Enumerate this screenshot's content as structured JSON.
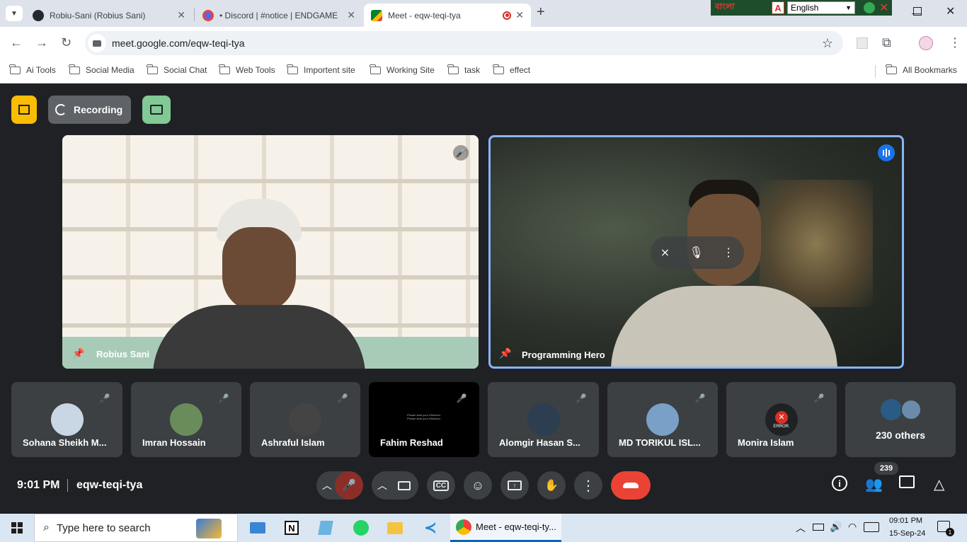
{
  "browser": {
    "tabs": [
      {
        "title": "Robiu-Sani (Robius Sani)",
        "icon": "github-icon"
      },
      {
        "title": "• Discord | #notice | ENDGAME",
        "icon": "discord-icon"
      },
      {
        "title": "Meet - eqw-teqi-tya",
        "icon": "meet-icon",
        "active": true,
        "recording": true
      }
    ],
    "new_tab": "+",
    "url": "meet.google.com/eqw-teqi-tya",
    "extension_language": "English",
    "extension_label": "বাংলা",
    "bookmarks": [
      "Ai Tools",
      "Social Media",
      "Social Chat",
      "Web Tools",
      "Importent site",
      "Working Site",
      "task",
      "effect"
    ],
    "all_bookmarks": "All Bookmarks"
  },
  "meet": {
    "recording_label": "Recording",
    "main_tiles": [
      {
        "name": "Robius Sani",
        "muted": true
      },
      {
        "name": "Programming Hero",
        "speaking": true
      }
    ],
    "participants": [
      {
        "name": "Sohana Sheikh M...",
        "avatar_color": "#c9d6e3"
      },
      {
        "name": "Imran Hossain",
        "avatar_color": "#6a8c5b"
      },
      {
        "name": "Ashraful Islam",
        "avatar_color": "#444"
      },
      {
        "name": "Fahim Reshad",
        "avatar_color": "#000"
      },
      {
        "name": "Alomgir Hasan S...",
        "avatar_color": "#2c3e50"
      },
      {
        "name": "MD TORIKUL ISL...",
        "avatar_color": "#7aa0c8"
      },
      {
        "name": "Monira Islam",
        "avatar_color": "#d93025",
        "avatar_text": "ERROR."
      }
    ],
    "fahim_tile_text": "Please start your Webcam. Please start your Webcam.",
    "others_label": "230 others",
    "time": "9:01 PM",
    "meeting_code": "eqw-teqi-tya",
    "people_count": "239",
    "colors": {
      "accent": "#8ab4f8",
      "end_call": "#ea4335",
      "recording_badge": "#fbbc04",
      "present_badge": "#81c995"
    }
  },
  "taskbar": {
    "search_placeholder": "Type here to search",
    "active_app": "Meet - eqw-teqi-ty...",
    "clock_time": "09:01 PM",
    "clock_date": "15-Sep-24",
    "notification_count": "1"
  }
}
